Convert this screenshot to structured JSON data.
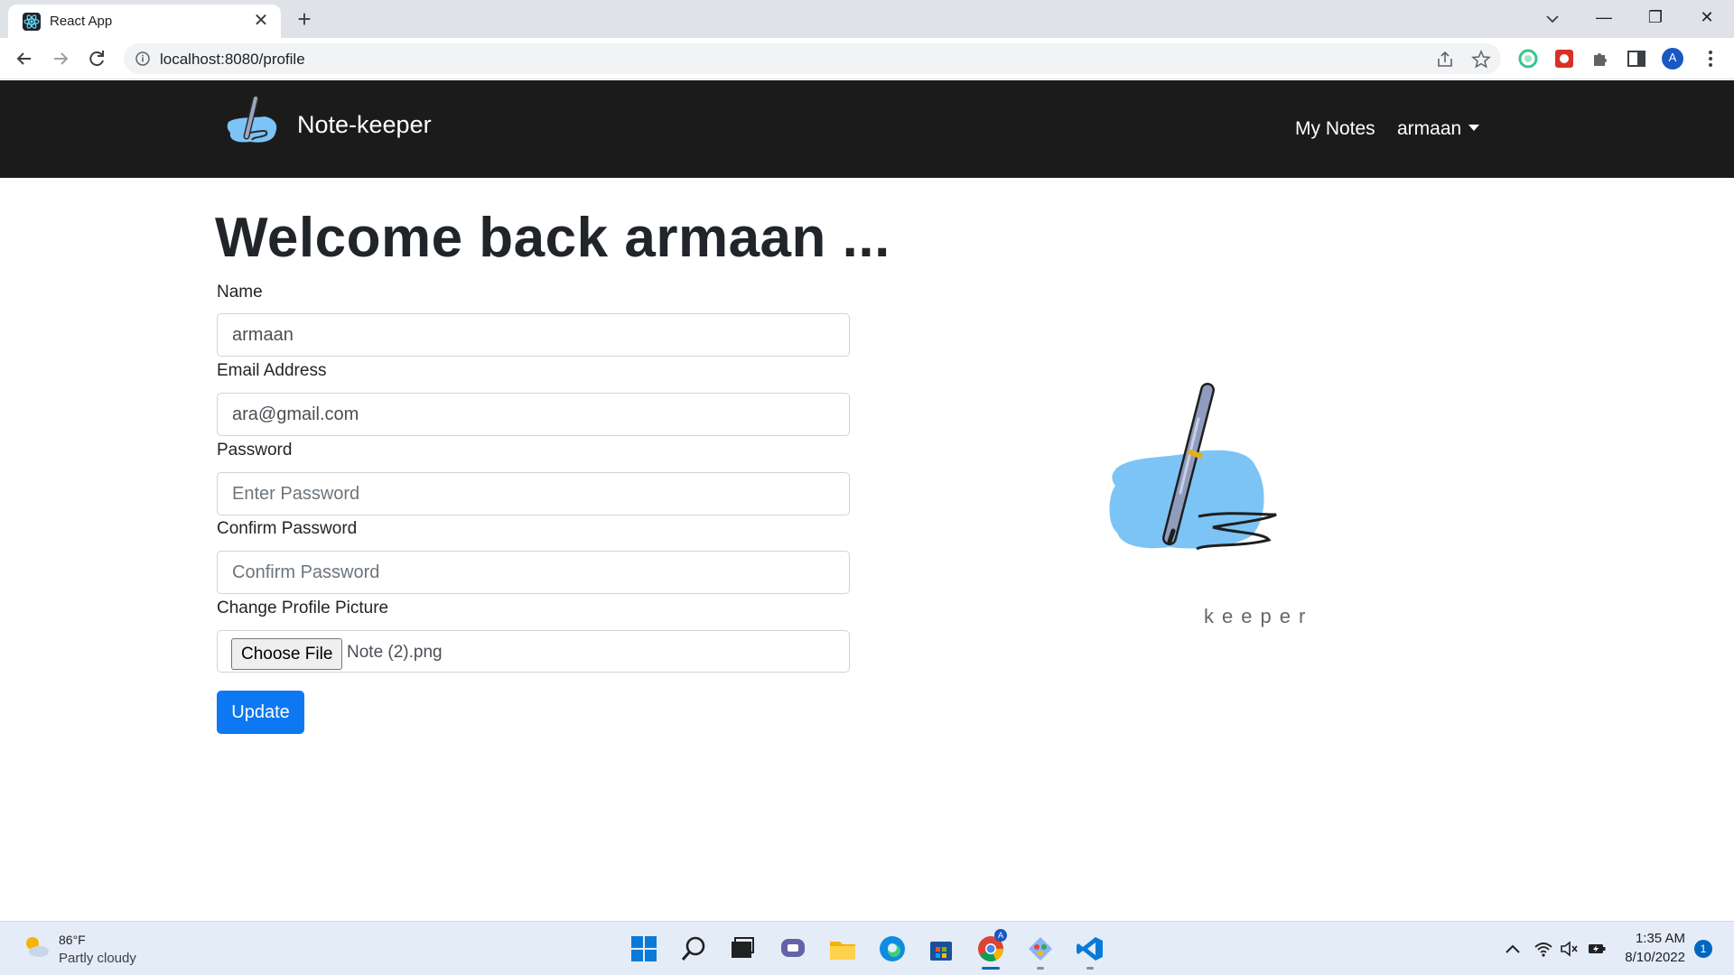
{
  "browser": {
    "tab_title": "React App",
    "tab_close": "✕",
    "new_tab": "+",
    "url": "localhost:8080/profile",
    "window_controls": {
      "minimize": "—",
      "restore": "❐",
      "close": "✕"
    },
    "profile_initial": "A"
  },
  "navbar": {
    "brand": "Note-keeper",
    "links": {
      "my_notes": "My Notes",
      "user": "armaan"
    }
  },
  "page": {
    "welcome": "Welcome back armaan ...",
    "form": {
      "name_label": "Name",
      "name_value": "armaan",
      "email_label": "Email Address",
      "email_value": "ara@gmail.com",
      "password_label": "Password",
      "password_placeholder": "Enter Password",
      "confirm_label": "Confirm Password",
      "confirm_placeholder": "Confirm Password",
      "picture_label": "Change Profile Picture",
      "choose_file": "Choose File",
      "file_name": "Note (2).png",
      "submit": "Update"
    },
    "hero_caption": "keeper"
  },
  "taskbar": {
    "weather_temp": "86°F",
    "weather_desc": "Partly cloudy",
    "time": "1:35 AM",
    "date": "8/10/2022",
    "notifications": "1",
    "chrome_badge": "A"
  },
  "colors": {
    "navbar_bg": "#1b1b1b",
    "primary_button": "#0d78f2",
    "logo_blue": "#7cc4f5"
  }
}
